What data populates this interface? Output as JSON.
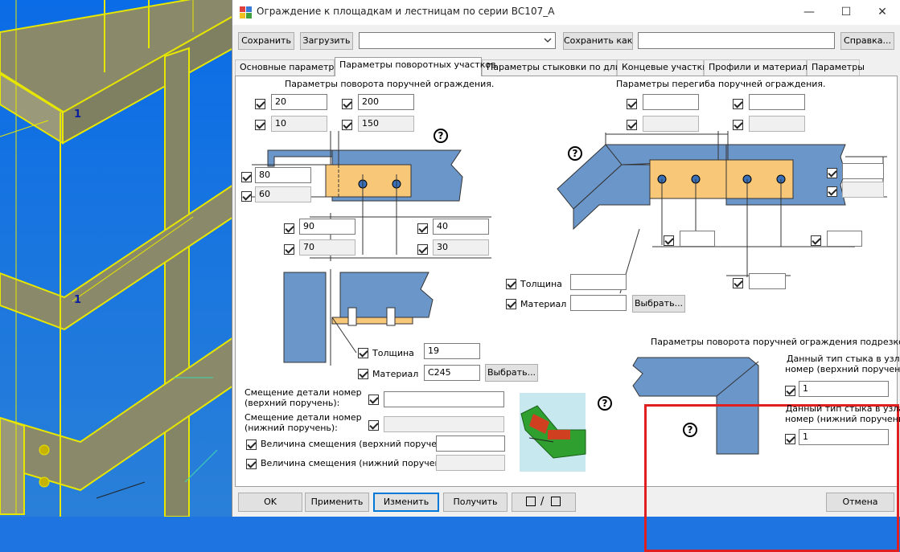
{
  "window": {
    "title": "Ограждение к площадкам и лестницам по серии ВС107_А",
    "minimize": "—",
    "maximize": "☐",
    "close": "✕"
  },
  "toolbar": {
    "save": "Сохранить",
    "load": "Загрузить",
    "preset_value": "",
    "save_as": "Сохранить как",
    "save_as_value": "",
    "help": "Справка..."
  },
  "tabs": [
    "Основные параметры",
    "Параметры поворотных участков",
    "Параметры стыковки по длине",
    "Концевые участки",
    "Профили и материалы",
    "Параметры"
  ],
  "active_tab": 1,
  "left_section": {
    "title": "Параметры  поворота  поручней ограждения.",
    "top_a": "20",
    "top_b": "10",
    "top_c": "200",
    "top_d": "150",
    "side_a": "80",
    "side_b": "60",
    "bot_a": "90",
    "bot_b": "70",
    "bot_c": "40",
    "bot_d": "30",
    "thickness_label": "Толщина",
    "thickness_value": "19",
    "material_label": "Материал",
    "material_value": "С245",
    "choose": "Выбрать..."
  },
  "right_section": {
    "title": "Параметры  перегиба  поручней ограждения.",
    "thickness_label": "Толщина",
    "thickness_value": "",
    "material_label": "Материал",
    "material_value": "",
    "choose": "Выбрать..."
  },
  "offset_section": {
    "upper_label_1": "Смещение детали номер",
    "upper_label_2": "(верхний поручень):",
    "lower_label_1": "Смещение детали номер",
    "lower_label_2": "(нижний поручень):",
    "upper_amount_label": "Величина смещения (верхний поручень):",
    "lower_amount_label": "Величина смещения (нижний поручень):",
    "upper_value": "",
    "lower_value": "",
    "upper_amount": "",
    "lower_amount": ""
  },
  "cut_section": {
    "title": "Параметры  поворота  поручней ограждения  подрезкой.",
    "upper_label_1": "Данный тип стыка в узлах",
    "upper_label_2": "номер (верхний поручень):",
    "upper_value": "1",
    "lower_label_1": "Данный тип стыка в узлах",
    "lower_label_2": "номер (нижний поручень):",
    "lower_value": "1"
  },
  "help_mark": "?",
  "model_labels": [
    "1",
    "1"
  ],
  "bottom": {
    "ok": "OK",
    "apply": "Применить",
    "modify": "Изменить",
    "get": "Получить",
    "toggle_sep": "/",
    "cancel": "Отмена"
  },
  "colors": {
    "part_blue": "#6b96c9",
    "plate_orange": "#f8c878",
    "highlight_red": "#e02020",
    "model_bg": "#1e74e0",
    "model_yellow": "#e6e600"
  }
}
